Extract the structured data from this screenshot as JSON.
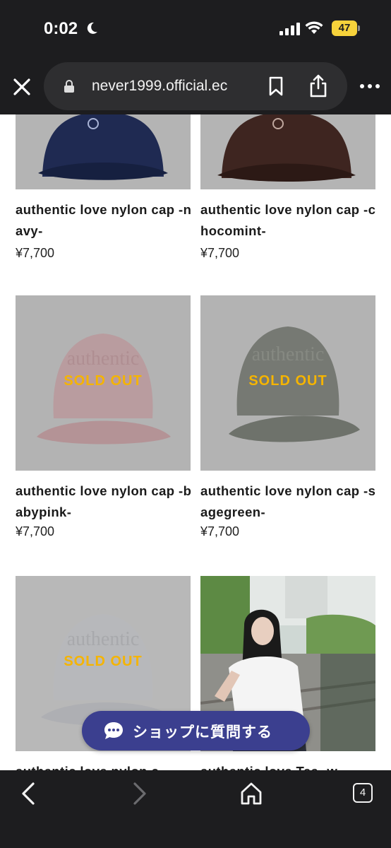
{
  "status_bar": {
    "time": "0:02",
    "battery": "47"
  },
  "browser": {
    "url": "never1999.official.ec"
  },
  "products": [
    {
      "name": "authentic love nylon cap -navy-",
      "price": "¥7,700",
      "sold_out": false,
      "color": "#1f2a52"
    },
    {
      "name": "authentic love nylon cap -chocomint-",
      "price": "¥7,700",
      "sold_out": false,
      "color": "#3e2520"
    },
    {
      "name": "authentic love nylon cap -babypink-",
      "price": "¥7,700",
      "sold_out": true,
      "sold_out_label": "SOLD OUT",
      "color": "#e8b3b8"
    },
    {
      "name": "authentic love nylon cap -sagegreen-",
      "price": "¥7,700",
      "sold_out": true,
      "sold_out_label": "SOLD OUT",
      "color": "#6e7468"
    },
    {
      "name": "authentic love nylon c",
      "price": "",
      "sold_out": true,
      "sold_out_label": "SOLD OUT",
      "color": "#d8dadf"
    },
    {
      "name": "authentic love Tee -w",
      "price": "",
      "sold_out": false
    }
  ],
  "chat_button": {
    "label": "ショップに質問する"
  },
  "toolbar": {
    "tab_count": "4"
  },
  "colors": {
    "chrome": "#1d1d1f",
    "url_pill": "#2e2e30",
    "sold_out_text": "#f5b400",
    "chat_button": "#3b3f8f",
    "battery": "#f6d23b"
  }
}
